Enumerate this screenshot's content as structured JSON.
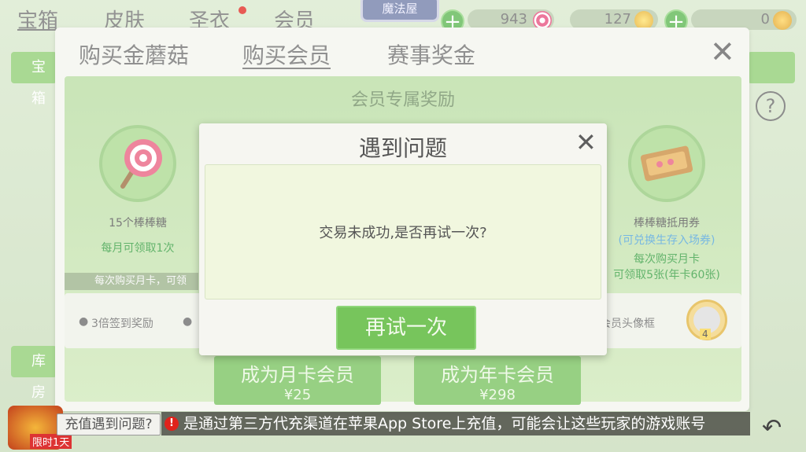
{
  "topnav": {
    "tabs": [
      "宝箱",
      "皮肤",
      "圣衣",
      "会员"
    ],
    "magic_badge": "魔法屋",
    "currency_candy": "943",
    "currency_gold": "127",
    "currency_coin": "0"
  },
  "background": {
    "side_top": "宝箱",
    "side_bottom": "库房"
  },
  "main_modal": {
    "tabs": [
      "购买金蘑菇",
      "购买会员",
      "赛事奖金"
    ],
    "active_tab": "购买会员",
    "section_title": "会员专属奖励",
    "left_reward": {
      "title": "15个棒棒糖",
      "subtitle": "每月可领取1次"
    },
    "right_reward": {
      "title": "棒棒糖抵用券",
      "subtitle": "(可兑换生存入场券)",
      "line3": "每次购买月卡",
      "line4": "可领取5张(年卡60张)"
    },
    "note_strip": "每次购买月卡，可领",
    "strip_left": "3倍签到奖励",
    "strip_right": "会员头像框",
    "avatar_level": "4",
    "buy_month": {
      "label": "成为月卡会员",
      "price": "¥25"
    },
    "buy_year": {
      "label": "成为年卡会员",
      "price": "¥298"
    }
  },
  "dialog": {
    "title": "遇到问题",
    "message": "交易未成功,是否再试一次?",
    "retry_label": "再试一次"
  },
  "footer": {
    "recharge_question": "充值遇到问题?",
    "ticker_text": "是通过第三方代充渠道在苹果App Store上充值，可能会让这些玩家的游戏账号",
    "limit_badge": "限时1天"
  },
  "help": "?",
  "colors": {
    "primary_green": "#74c15a",
    "modal_bg": "#f3f4ee",
    "dialog_body_bg": "#f1f7df",
    "alert_red": "#e0231b"
  }
}
